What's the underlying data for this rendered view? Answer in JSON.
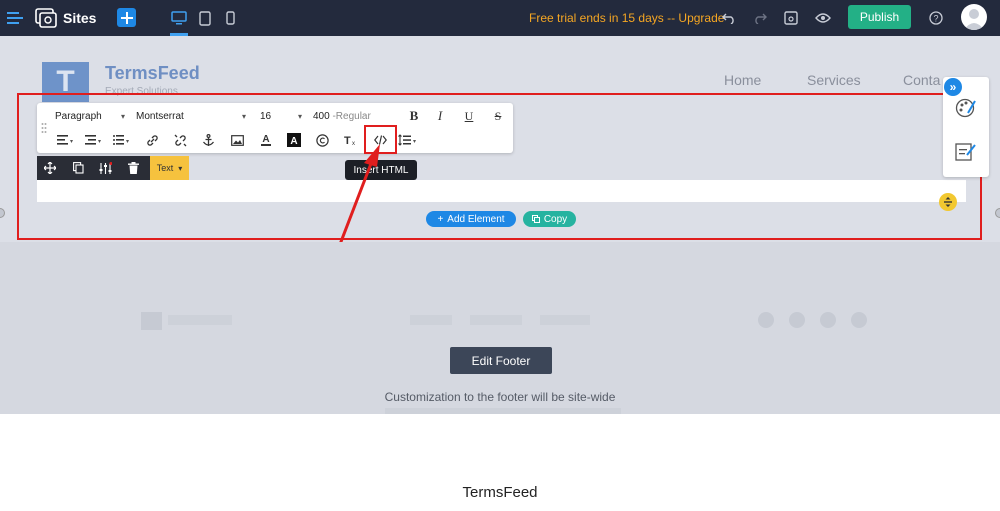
{
  "topbar": {
    "sites_label": "Sites",
    "trial_text": "Free trial ends in 15 days -- Upgrade",
    "publish_label": "Publish",
    "colors": {
      "bg": "#232a3d",
      "accent": "#1e88e5",
      "trial": "#f5a623",
      "publish": "#23b086"
    }
  },
  "site": {
    "logo_letter": "T",
    "logo_name": "TermsFeed",
    "logo_tagline": "Expert Solutions",
    "nav": [
      "Home",
      "Services",
      "Conta"
    ]
  },
  "editor": {
    "block_type": "Paragraph",
    "font_family": "Montserrat",
    "font_size": "16",
    "font_weight": "400",
    "font_weight_label": "-Regular",
    "tooltip": "Insert HTML",
    "element_type": "Text",
    "add_element_label": "Add Element",
    "copy_label": "Copy",
    "icons": [
      "move-icon",
      "duplicate-icon",
      "settings-sliders-icon",
      "trash-icon",
      "bold-icon",
      "italic-icon",
      "underline-icon",
      "strikethrough-icon",
      "align-left-icon",
      "indent-icon",
      "list-icon",
      "link-icon",
      "unlink-icon",
      "anchor-icon",
      "image-icon",
      "text-color-icon",
      "highlight-color-icon",
      "copyright-icon",
      "clear-format-icon",
      "code-icon",
      "line-height-icon"
    ]
  },
  "footer": {
    "edit_label": "Edit Footer",
    "note": "Customization to the footer will be site-wide"
  },
  "page_footer_text": "TermsFeed"
}
